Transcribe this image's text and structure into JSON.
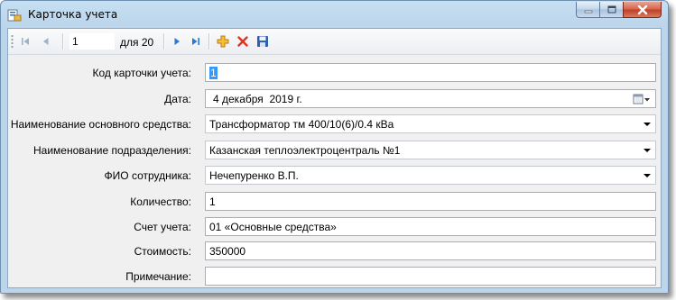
{
  "window": {
    "title": "Карточка учета",
    "caption": {
      "minimize": "minimize",
      "maximize": "maximize",
      "close": "close"
    }
  },
  "navigator": {
    "position": "1",
    "count_label": "для 20"
  },
  "form": {
    "fields": [
      {
        "label": "Код карточки учета:",
        "value": "1"
      },
      {
        "label": "Дата:",
        "value": "4 декабря  2019 г."
      },
      {
        "label": "Наименование основного средства:",
        "value": "Трансформатор тм 400/10(6)/0.4 кВа"
      },
      {
        "label": "Наименование подразделения:",
        "value": "Казанская теплоэлектроцентраль №1"
      },
      {
        "label": "ФИО сотрудника:",
        "value": "Нечепуренко В.П."
      },
      {
        "label": "Количество:",
        "value": "1"
      },
      {
        "label": "Счет учета:",
        "value": "01 «Основные средства»"
      },
      {
        "label": "Стоимость:",
        "value": "350000"
      },
      {
        "label": "Примечание:",
        "value": ""
      }
    ]
  },
  "colors": {
    "nav_blue": "#2a78d1",
    "add_orange": "#e8a31c",
    "delete_red": "#e0341c",
    "save_blue": "#2f5fb0",
    "close_red": "#c0412a"
  },
  "icons": {
    "app": "form-icon",
    "first": "move-first-icon",
    "prev": "move-previous-icon",
    "next": "move-next-icon",
    "last": "move-last-icon",
    "add": "add-new-icon",
    "delete": "delete-icon",
    "save": "save-icon",
    "calendar": "calendar-dropdown-icon",
    "dropdown": "chevron-down-icon"
  }
}
